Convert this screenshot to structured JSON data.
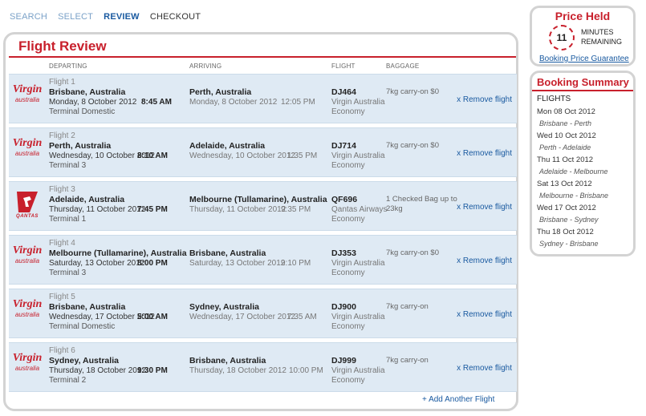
{
  "steps": [
    {
      "label": "SEARCH",
      "state": "link"
    },
    {
      "label": "SELECT",
      "state": "link"
    },
    {
      "label": "REVIEW",
      "state": "current"
    },
    {
      "label": "CHECKOUT",
      "state": "next"
    }
  ],
  "review": {
    "title": "Flight Review",
    "headers": {
      "departing": "DEPARTING",
      "arriving": "ARRIVING",
      "flight": "FLIGHT",
      "baggage": "BAGGAGE"
    },
    "remove_label": "x Remove flight",
    "add_label": "+  Add Another Flight",
    "flights": [
      {
        "num": "Flight 1",
        "logo": "virgin",
        "dep_city": "Brisbane, Australia",
        "dep_date": "Monday, 8 October 2012",
        "dep_time": "8:45 AM",
        "dep_terminal": "Terminal Domestic",
        "arr_city": "Perth, Australia",
        "arr_date": "Monday, 8 October 2012",
        "arr_time": "12:05 PM",
        "code": "DJ464",
        "airline": "Virgin Australia",
        "cabin": "Economy",
        "baggage": "7kg carry-on $0"
      },
      {
        "num": "Flight 2",
        "logo": "virgin",
        "dep_city": "Perth, Australia",
        "dep_date": "Wednesday, 10 October 2012",
        "dep_time": "8:10 AM",
        "dep_terminal": "Terminal 3",
        "arr_city": "Adelaide, Australia",
        "arr_date": "Wednesday, 10 October 2012",
        "arr_time": "1:35 PM",
        "code": "DJ714",
        "airline": "Virgin Australia",
        "cabin": "Economy",
        "baggage": "7kg carry-on $0"
      },
      {
        "num": "Flight 3",
        "logo": "qantas",
        "dep_city": "Adelaide, Australia",
        "dep_date": "Thursday, 11 October 2012",
        "dep_time": "7:45 PM",
        "dep_terminal": "Terminal 1",
        "arr_city": "Melbourne (Tullamarine), Australia",
        "arr_date": "Thursday, 11 October 2012",
        "arr_time": "9:35 PM",
        "code": "QF696",
        "airline": "Qantas Airways",
        "cabin": "Economy",
        "baggage": "1 Checked Bag up to 23kg"
      },
      {
        "num": "Flight 4",
        "logo": "virgin",
        "dep_city": "Melbourne (Tullamarine), Australia",
        "dep_date": "Saturday, 13 October 2012",
        "dep_time": "8:00 PM",
        "dep_terminal": "Terminal 3",
        "arr_city": "Brisbane, Australia",
        "arr_date": "Saturday, 13 October 2012",
        "arr_time": "9:10 PM",
        "code": "DJ353",
        "airline": "Virgin Australia",
        "cabin": "Economy",
        "baggage": "7kg carry-on $0"
      },
      {
        "num": "Flight 5",
        "logo": "virgin",
        "dep_city": "Brisbane, Australia",
        "dep_date": "Wednesday, 17 October 2012",
        "dep_time": "5:00 AM",
        "dep_terminal": "Terminal Domestic",
        "arr_city": "Sydney, Australia",
        "arr_date": "Wednesday, 17 October 2012",
        "arr_time": "7:35 AM",
        "code": "DJ900",
        "airline": "Virgin Australia",
        "cabin": "Economy",
        "baggage": "7kg carry-on"
      },
      {
        "num": "Flight 6",
        "logo": "virgin",
        "dep_city": "Sydney, Australia",
        "dep_date": "Thursday, 18 October 2012",
        "dep_time": "9:30 PM",
        "dep_terminal": "Terminal 2",
        "arr_city": "Brisbane, Australia",
        "arr_date": "Thursday, 18 October 2012",
        "arr_time": "10:00 PM",
        "code": "DJ999",
        "airline": "Virgin Australia",
        "cabin": "Economy",
        "baggage": "7kg carry-on"
      }
    ]
  },
  "logos": {
    "virgin": {
      "mark": "Virgin",
      "sub": "australia"
    },
    "qantas": {
      "name": "QANTAS"
    }
  },
  "held": {
    "title": "Price Held",
    "minutes": "11",
    "units_line1": "MINUTES",
    "units_line2": "REMAINING",
    "link": "Booking Price Guarantee"
  },
  "summary": {
    "title": "Booking Summary",
    "flights_label": "FLIGHTS",
    "entries": [
      {
        "date": "Mon 08 Oct 2012",
        "route": "Brisbane - Perth"
      },
      {
        "date": "Wed 10 Oct 2012",
        "route": "Perth - Adelaide"
      },
      {
        "date": "Thu 11 Oct 2012",
        "route": "Adelaide - Melbourne"
      },
      {
        "date": "Sat 13 Oct 2012",
        "route": "Melbourne - Brisbane"
      },
      {
        "date": "Wed 17 Oct 2012",
        "route": "Brisbane - Sydney"
      },
      {
        "date": "Thu 18 Oct 2012",
        "route": "Sydney - Brisbane"
      }
    ]
  },
  "colors": {
    "accent": "#c8202c",
    "link": "#1a5aa0",
    "row_bg": "#dfeaf4"
  }
}
